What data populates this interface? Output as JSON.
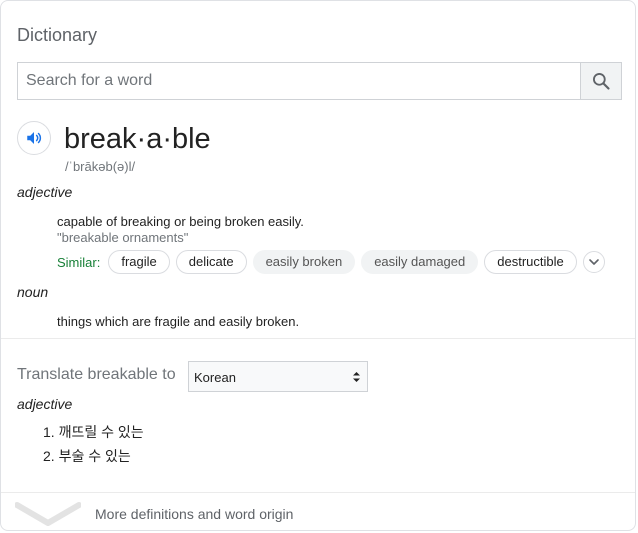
{
  "header": {
    "title": "Dictionary"
  },
  "search": {
    "placeholder": "Search for a word",
    "value": ""
  },
  "entry": {
    "headword": "break·a·ble",
    "phonetic": "/ˈbrākəb(ə)l/",
    "senses": [
      {
        "pos": "adjective",
        "definition": "capable of breaking or being broken easily.",
        "example": "\"breakable ornaments\"",
        "similar_label": "Similar:",
        "similar": [
          {
            "word": "fragile",
            "style": "outlined"
          },
          {
            "word": "delicate",
            "style": "outlined"
          },
          {
            "word": "easily broken",
            "style": "filled"
          },
          {
            "word": "easily damaged",
            "style": "filled"
          },
          {
            "word": "destructible",
            "style": "outlined"
          }
        ]
      },
      {
        "pos": "noun",
        "definition": "things which are fragile and easily broken."
      }
    ]
  },
  "translate": {
    "label": "Translate breakable to",
    "language": "Korean",
    "pos": "adjective",
    "items": [
      "1. 깨뜨릴 수 있는",
      "2. 부술 수 있는"
    ]
  },
  "footer": {
    "more_link": "More definitions and word origin"
  },
  "colors": {
    "speaker": "#1a73e8",
    "similar_label": "#188038",
    "chip_filled": "#f1f3f4"
  },
  "icons": [
    "search-icon",
    "speaker-icon",
    "chevron-down-icon",
    "select-arrows-icon"
  ]
}
